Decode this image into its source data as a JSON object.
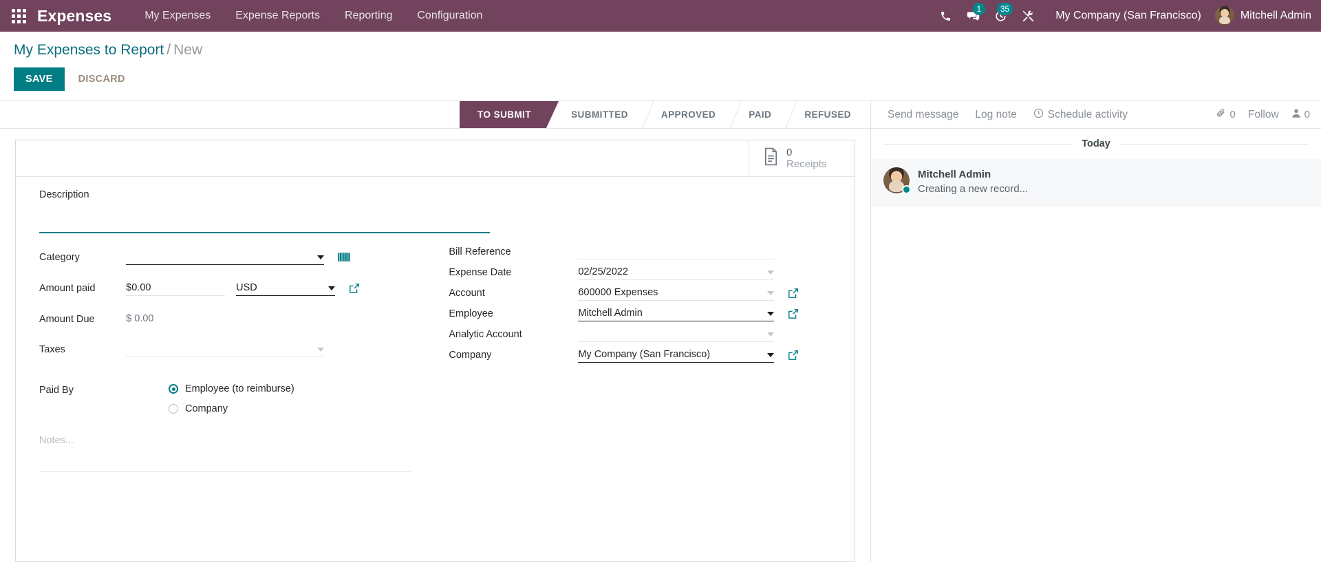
{
  "navbar": {
    "apps_icon": "apps-grid-icon",
    "brand": "Expenses",
    "menus": [
      "My Expenses",
      "Expense Reports",
      "Reporting",
      "Configuration"
    ],
    "icons": [
      {
        "name": "phone-icon",
        "glyph": "phone",
        "badge": null
      },
      {
        "name": "messages-icon",
        "glyph": "chat",
        "badge": "1"
      },
      {
        "name": "activities-icon",
        "glyph": "clock",
        "badge": "35"
      },
      {
        "name": "debug-tools-icon",
        "glyph": "wrench",
        "badge": null
      }
    ],
    "company": "My Company (San Francisco)",
    "user": "Mitchell Admin",
    "accent": "#71435c",
    "badge_color": "#00888f"
  },
  "control_panel": {
    "breadcrumb_parent": "My Expenses to Report",
    "breadcrumb_sep": "/",
    "breadcrumb_current": "New",
    "save_label": "SAVE",
    "discard_label": "DISCARD",
    "save_color": "#017e84"
  },
  "statusbar": {
    "stages": [
      "TO SUBMIT",
      "SUBMITTED",
      "APPROVED",
      "PAID",
      "REFUSED"
    ],
    "active": "TO SUBMIT"
  },
  "chatter_topbar": {
    "send_message": "Send message",
    "log_note": "Log note",
    "schedule_activity": "Schedule activity",
    "attachment_count": "0",
    "follow_label": "Follow",
    "follower_count": "0"
  },
  "smart_buttons": [
    {
      "name": "receipts-button",
      "value": "0",
      "label": "Receipts",
      "icon": "document-icon"
    }
  ],
  "form": {
    "description": {
      "label": "Description",
      "value": "",
      "placeholder": ""
    },
    "left_fields": [
      {
        "label": "Category",
        "value": "",
        "placeholder": "",
        "widget": "many2one",
        "icon": "barcode-icon"
      },
      {
        "label": "Amount paid",
        "value": "$0.00",
        "currency": "USD",
        "widget": "monetary",
        "icon": "external-link-icon"
      },
      {
        "label": "Amount Due",
        "value": "$ 0.00",
        "widget": "readonly"
      },
      {
        "label": "Taxes",
        "value": "",
        "placeholder": "",
        "widget": "many2many"
      }
    ],
    "right_fields": [
      {
        "label": "Bill Reference",
        "value": "",
        "placeholder": "",
        "widget": "char"
      },
      {
        "label": "Expense Date",
        "value": "02/25/2022",
        "widget": "date"
      },
      {
        "label": "Account",
        "value": "600000 Expenses",
        "widget": "many2one",
        "icon": "external-link-icon"
      },
      {
        "label": "Employee",
        "value": "Mitchell Admin",
        "widget": "many2one",
        "icon": "external-link-icon"
      },
      {
        "label": "Analytic Account",
        "value": "",
        "placeholder": "",
        "widget": "many2one"
      },
      {
        "label": "Company",
        "value": "My Company (San Francisco)",
        "widget": "many2one",
        "icon": "external-link-icon"
      }
    ],
    "paid_by": {
      "label": "Paid By",
      "options": [
        {
          "label": "Employee (to reimburse)",
          "selected": true
        },
        {
          "label": "Company",
          "selected": false
        }
      ]
    },
    "notes": {
      "value": "",
      "placeholder": "Notes..."
    }
  },
  "chatter": {
    "day_separator": "Today",
    "messages": [
      {
        "author": "Mitchell Admin",
        "text": "Creating a new record...",
        "avatar": "user-avatar",
        "online": true
      }
    ]
  }
}
